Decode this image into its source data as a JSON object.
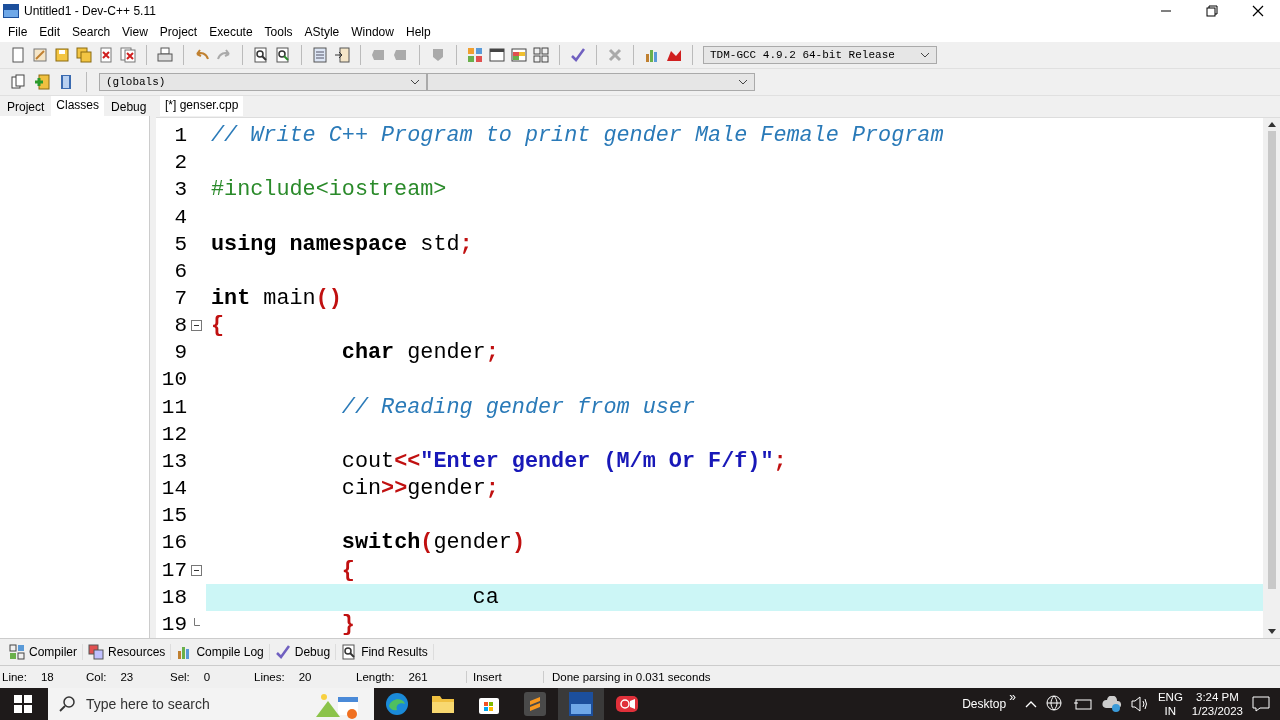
{
  "window": {
    "title": "Untitled1 - Dev-C++ 5.11"
  },
  "menu": [
    "File",
    "Edit",
    "Search",
    "View",
    "Project",
    "Execute",
    "Tools",
    "AStyle",
    "Window",
    "Help"
  ],
  "compiler_select": {
    "value": "TDM-GCC 4.9.2 64-bit Release"
  },
  "scope_select": {
    "value": "(globals)"
  },
  "side_tabs": [
    {
      "label": "Project",
      "selected": false
    },
    {
      "label": "Classes",
      "selected": true
    },
    {
      "label": "Debug",
      "selected": false
    }
  ],
  "editor_tabs": [
    {
      "label": "[*] genser.cpp",
      "selected": true
    }
  ],
  "code_lines": [
    {
      "number": "1",
      "kind": "code",
      "current": false,
      "tokens": [
        {
          "kind": "comment",
          "text": "// Write C++ Program to print gender Male Female Program"
        }
      ]
    },
    {
      "number": "2",
      "kind": "code",
      "current": false
    },
    {
      "number": "3",
      "kind": "code",
      "current": false,
      "tokens": [
        {
          "kind": "preproc",
          "text": "#include<iostream>"
        }
      ]
    },
    {
      "number": "4",
      "kind": "code",
      "current": false
    },
    {
      "number": "5",
      "kind": "code",
      "current": false,
      "tokens": [
        {
          "kind": "keyword",
          "text": "using namespace"
        },
        {
          "kind": "plain",
          "text": " std"
        },
        {
          "kind": "symbol",
          "text": ";"
        }
      ]
    },
    {
      "number": "6",
      "kind": "code",
      "current": false
    },
    {
      "number": "7",
      "kind": "code",
      "current": false,
      "tokens": [
        {
          "kind": "keyword",
          "text": "int"
        },
        {
          "kind": "plain",
          "text": " main"
        },
        {
          "kind": "symbol",
          "text": "()"
        }
      ]
    },
    {
      "number": "8",
      "kind": "fold_start",
      "current": false,
      "tokens": [
        {
          "kind": "symbol",
          "text": "{"
        }
      ]
    },
    {
      "number": "9",
      "kind": "code",
      "current": false,
      "tokens": [
        {
          "kind": "keyword",
          "text": "\tchar"
        },
        {
          "kind": "plain",
          "text": " gender"
        },
        {
          "kind": "symbol",
          "text": ";"
        }
      ]
    },
    {
      "number": "10",
      "kind": "code",
      "current": false
    },
    {
      "number": "11",
      "kind": "code",
      "current": false,
      "tokens": [
        {
          "kind": "comment",
          "text": "\t// Reading gender from user"
        }
      ]
    },
    {
      "number": "12",
      "kind": "code",
      "current": false
    },
    {
      "number": "13",
      "kind": "code",
      "current": false,
      "tokens": [
        {
          "kind": "plain",
          "text": "\tcout"
        },
        {
          "kind": "symbol",
          "text": "<<"
        },
        {
          "kind": "string",
          "text": "\"Enter gender (M/m Or F/f)\""
        },
        {
          "kind": "symbol",
          "text": ";"
        }
      ]
    },
    {
      "number": "14",
      "kind": "code",
      "current": false,
      "tokens": [
        {
          "kind": "plain",
          "text": "\tcin"
        },
        {
          "kind": "symbol",
          "text": ">>"
        },
        {
          "kind": "plain",
          "text": "gender"
        },
        {
          "kind": "symbol",
          "text": ";"
        }
      ]
    },
    {
      "number": "15",
      "kind": "code",
      "current": false
    },
    {
      "number": "16",
      "kind": "code",
      "current": false,
      "tokens": [
        {
          "kind": "keyword",
          "text": "\tswitch"
        },
        {
          "kind": "symbol",
          "text": "("
        },
        {
          "kind": "plain",
          "text": "gender"
        },
        {
          "kind": "symbol",
          "text": ")"
        }
      ]
    },
    {
      "number": "17",
      "kind": "fold_start",
      "current": false,
      "tokens": [
        {
          "kind": "symbol",
          "text": "\t{"
        }
      ]
    },
    {
      "number": "18",
      "kind": "code",
      "current": true,
      "tokens": [
        {
          "kind": "plain",
          "text": "\t\tca"
        }
      ]
    },
    {
      "number": "19",
      "kind": "fold_end",
      "current": false,
      "tokens": [
        {
          "kind": "symbol",
          "text": "\t}"
        }
      ]
    }
  ],
  "bottom_tabs": [
    {
      "label": "Compiler"
    },
    {
      "label": "Resources"
    },
    {
      "label": "Compile Log"
    },
    {
      "label": "Debug"
    },
    {
      "label": "Find Results"
    }
  ],
  "status_bar": [
    {
      "label": "Line:",
      "value": "18"
    },
    {
      "label": "Col:",
      "value": "23"
    },
    {
      "label": "Sel:",
      "value": "0"
    },
    {
      "label": "Lines:",
      "value": "20"
    },
    {
      "label": "Length:",
      "value": "261"
    }
  ],
  "status_mode": "Insert",
  "status_message": "Done parsing in 0.031 seconds",
  "taskbar": {
    "search": {
      "placeholder": "Type here to search"
    },
    "desktop": "Desktop",
    "more": "»",
    "language": "ENG",
    "region": "IN",
    "time": "3:24 PM",
    "date": "1/23/2023"
  }
}
